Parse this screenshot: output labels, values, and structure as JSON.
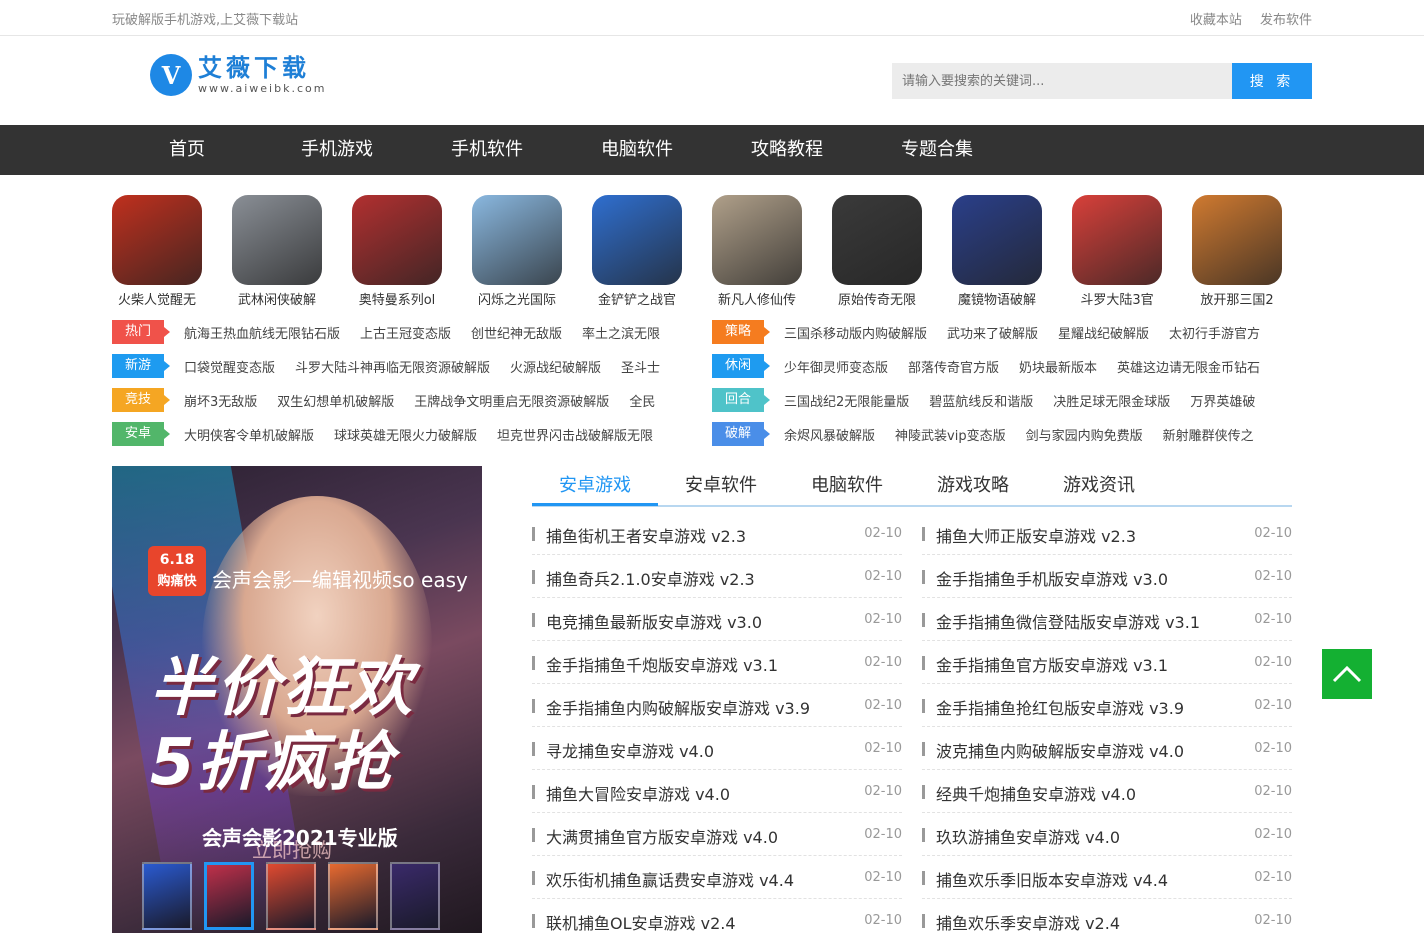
{
  "topbar": {
    "slogan": "玩破解版手机游戏,上艾薇下载站",
    "links": [
      "收藏本站",
      "发布软件"
    ]
  },
  "logo": {
    "mark": "V",
    "name": "艾薇下载",
    "url": "www.aiweibk.com"
  },
  "search": {
    "placeholder": "请输入要搜索的关键词...",
    "button": "搜 索"
  },
  "nav": [
    "首页",
    "手机游戏",
    "手机软件",
    "电脑软件",
    "攻略教程",
    "专题合集"
  ],
  "apps": [
    {
      "label": "火柴人觉醒无",
      "color": "#c0301e"
    },
    {
      "label": "武林闲侠破解",
      "color": "#8a8f96"
    },
    {
      "label": "奥特曼系列ol",
      "color": "#b23030"
    },
    {
      "label": "闪烁之光国际",
      "color": "#8ab8e0"
    },
    {
      "label": "金铲铲之战官",
      "color": "#2f6fd0"
    },
    {
      "label": "新凡人修仙传",
      "color": "#b0a08a"
    },
    {
      "label": "原始传奇无限",
      "color": "#3a3a3a"
    },
    {
      "label": "魔镜物语破解",
      "color": "#2a3f8a"
    },
    {
      "label": "斗罗大陆3官",
      "color": "#d8403a"
    },
    {
      "label": "放开那三国2",
      "color": "#d07a30"
    }
  ],
  "tag_rows": [
    {
      "left": {
        "label": "热门",
        "color": "#f0524a",
        "links": [
          "航海王热血航线无限钻石版",
          "上古王冠变态版",
          "创世纪神无敌版",
          "率土之滨无限"
        ]
      },
      "right": {
        "label": "策略",
        "color": "#f57c1f",
        "links": [
          "三国杀移动版内购破解版",
          "武功来了破解版",
          "星耀战纪破解版",
          "太初行手游官方"
        ]
      }
    },
    {
      "left": {
        "label": "新游",
        "color": "#1e9bf0",
        "links": [
          "口袋觉醒变态版",
          "斗罗大陆斗神再临无限资源破解版",
          "火源战纪破解版",
          "圣斗士"
        ]
      },
      "right": {
        "label": "休闲",
        "color": "#1e9bf0",
        "links": [
          "少年御灵师变态版",
          "部落传奇官方版",
          "奶块最新版本",
          "英雄这边请无限金币钻石"
        ]
      }
    },
    {
      "left": {
        "label": "竞技",
        "color": "#f5a623",
        "links": [
          "崩坏3无敌版",
          "双生幻想单机破解版",
          "王牌战争文明重启无限资源破解版",
          "全民"
        ]
      },
      "right": {
        "label": "回合",
        "color": "#4fc3c9",
        "links": [
          "三国战纪2无限能量版",
          "碧蓝航线反和谐版",
          "决胜足球无限金球版",
          "万界英雄破"
        ]
      }
    },
    {
      "left": {
        "label": "安卓",
        "color": "#52b66a",
        "links": [
          "大明侠客令单机破解版",
          "球球英雄无限火力破解版",
          "坦克世界闪击战破解版无限"
        ]
      },
      "right": {
        "label": "破解",
        "color": "#4a8ee8",
        "links": [
          "余烬风暴破解版",
          "神陵武装vip变态版",
          "剑与家园内购免费版",
          "新射雕群侠传之"
        ]
      }
    }
  ],
  "banner": {
    "badge_line1": "6.18",
    "badge_line2": "购痛快",
    "slogan": "会声会影—编辑视频so easy",
    "headline1": "半价狂欢",
    "headline2": "5折疯抢",
    "product": "会声会影2021专业版",
    "cta": "立即抢购",
    "active_thumb": 1
  },
  "tabs": [
    "安卓游戏",
    "安卓软件",
    "电脑软件",
    "游戏攻略",
    "游戏资讯"
  ],
  "active_tab": 0,
  "list_left": [
    {
      "title": "捕鱼街机王者安卓游戏 v2.3",
      "date": "02-10"
    },
    {
      "title": "捕鱼奇兵2.1.0安卓游戏 v2.3",
      "date": "02-10"
    },
    {
      "title": "电竞捕鱼最新版安卓游戏 v3.0",
      "date": "02-10"
    },
    {
      "title": "金手指捕鱼千炮版安卓游戏 v3.1",
      "date": "02-10"
    },
    {
      "title": "金手指捕鱼内购破解版安卓游戏 v3.9",
      "date": "02-10"
    },
    {
      "title": "寻龙捕鱼安卓游戏 v4.0",
      "date": "02-10"
    },
    {
      "title": "捕鱼大冒险安卓游戏 v4.0",
      "date": "02-10"
    },
    {
      "title": "大满贯捕鱼官方版安卓游戏 v4.0",
      "date": "02-10"
    },
    {
      "title": "欢乐街机捕鱼赢话费安卓游戏 v4.4",
      "date": "02-10"
    },
    {
      "title": "联机捕鱼OL安卓游戏 v2.4",
      "date": "02-10"
    }
  ],
  "list_right": [
    {
      "title": "捕鱼大师正版安卓游戏 v2.3",
      "date": "02-10"
    },
    {
      "title": "金手指捕鱼手机版安卓游戏 v3.0",
      "date": "02-10"
    },
    {
      "title": "金手指捕鱼微信登陆版安卓游戏 v3.1",
      "date": "02-10"
    },
    {
      "title": "金手指捕鱼官方版安卓游戏 v3.1",
      "date": "02-10"
    },
    {
      "title": "金手指捕鱼抢红包版安卓游戏 v3.9",
      "date": "02-10"
    },
    {
      "title": "波克捕鱼内购破解版安卓游戏 v4.0",
      "date": "02-10"
    },
    {
      "title": "经典千炮捕鱼安卓游戏 v4.0",
      "date": "02-10"
    },
    {
      "title": "玖玖游捕鱼安卓游戏 v4.0",
      "date": "02-10"
    },
    {
      "title": "捕鱼欢乐季旧版本安卓游戏 v4.4",
      "date": "02-10"
    },
    {
      "title": "捕鱼欢乐季安卓游戏 v2.4",
      "date": "02-10"
    }
  ],
  "back_to_top_icon": "chevron-up-icon",
  "colors": {
    "accent": "#2196f3",
    "nav_bg": "#333333",
    "back_to_top": "#14b032"
  }
}
